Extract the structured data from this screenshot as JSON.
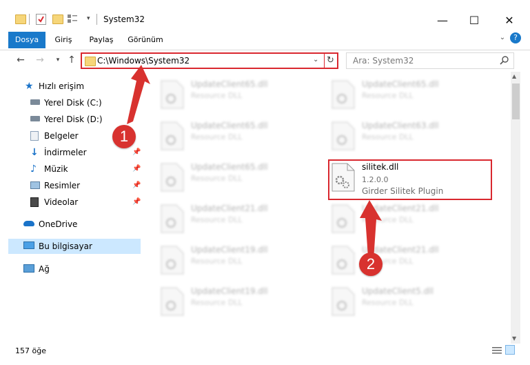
{
  "window": {
    "title": "System32",
    "minimize_glyph": "—",
    "maximize_glyph": "☐",
    "close_glyph": "✕",
    "help_glyph": "?"
  },
  "ribbon": {
    "tabs": [
      "Dosya",
      "Giriş",
      "Paylaş",
      "Görünüm"
    ]
  },
  "address": {
    "path": "C:\\Windows\\System32",
    "search_placeholder": "Ara: System32"
  },
  "sidebar": {
    "items": [
      {
        "label": "Hızlı erişim",
        "icon": "star-icon"
      },
      {
        "label": "Yerel Disk (C:)",
        "icon": "drive-icon"
      },
      {
        "label": "Yerel Disk (D:)",
        "icon": "drive-icon"
      },
      {
        "label": "Belgeler",
        "icon": "documents-icon"
      },
      {
        "label": "İndirmeler",
        "icon": "download-icon"
      },
      {
        "label": "Müzik",
        "icon": "music-icon"
      },
      {
        "label": "Resimler",
        "icon": "pictures-icon"
      },
      {
        "label": "Videolar",
        "icon": "videos-icon"
      },
      {
        "label": "OneDrive",
        "icon": "cloud-icon"
      },
      {
        "label": "Bu bilgisayar",
        "icon": "computer-icon"
      },
      {
        "label": "Ağ",
        "icon": "network-icon"
      }
    ]
  },
  "files": {
    "left_column": [
      {
        "name": "UpdateClient65.dll",
        "desc": "Resource DLL"
      },
      {
        "name": "UpdateClient65.dll",
        "desc": "Resource DLL"
      },
      {
        "name": "UpdateClient65.dll",
        "desc": "Resource DLL"
      },
      {
        "name": "UpdateClient21.dll",
        "desc": "Resource DLL"
      },
      {
        "name": "UpdateClient19.dll",
        "desc": "Resource DLL"
      },
      {
        "name": "UpdateClient19.dll",
        "desc": "Resource DLL"
      }
    ],
    "right_column": [
      {
        "name": "UpdateClient65.dll",
        "desc": "Resource DLL"
      },
      {
        "name": "UpdateClient63.dll",
        "desc": "Resource DLL"
      },
      {
        "name": "UpdateClient21.dll",
        "desc": "Resource DLL"
      },
      {
        "name": "UpdateClient21.dll",
        "desc": "Resource DLL"
      },
      {
        "name": "UpdateClient5.dll",
        "desc": "Resource DLL"
      }
    ],
    "highlighted": {
      "name": "silitek.dll",
      "version": "1.2.0.0",
      "description": "Girder Silitek Plugin"
    }
  },
  "status": {
    "count": "157 öğe"
  },
  "annotations": {
    "badge1": "1",
    "badge2": "2"
  },
  "colors": {
    "accent": "#1979ca",
    "highlight_red": "#d9272e",
    "selected_bg": "#cce8ff"
  }
}
